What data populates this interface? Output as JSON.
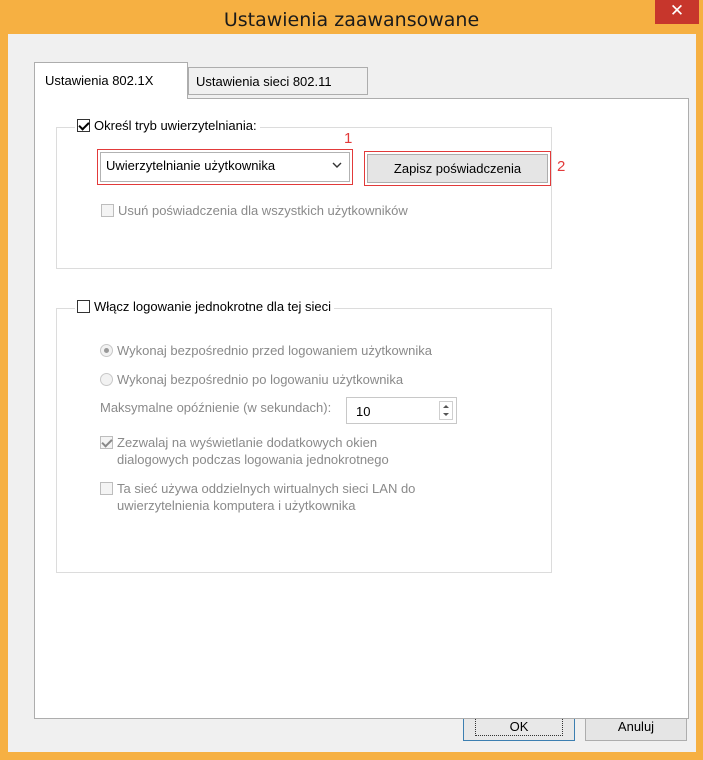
{
  "window": {
    "title": "Ustawienia zaawansowane",
    "close_label": "✕"
  },
  "tabs": [
    {
      "label": "Ustawienia 802.1X",
      "active": true
    },
    {
      "label": "Ustawienia sieci 802.11",
      "active": false
    }
  ],
  "auth_group": {
    "checkbox_label": "Określ tryb uwierzytelniania:",
    "checked": true,
    "mode_selected": "Uwierzytelnianie użytkownika",
    "save_credentials_label": "Zapisz poświadczenia",
    "delete_credentials_label": "Usuń poświadczenia dla wszystkich użytkowników",
    "marker_1": "1",
    "marker_2": "2"
  },
  "sso_group": {
    "checkbox_label": "Włącz logowanie jednokrotne dla tej sieci",
    "checked": false,
    "radio_before": "Wykonaj bezpośrednio przed logowaniem użytkownika",
    "radio_after": "Wykonaj bezpośrednio po logowaniu użytkownika",
    "delay_label": "Maksymalne opóźnienie (w sekundach):",
    "delay_value": "10",
    "allow_dialogs_line1": "Zezwalaj na wyświetlanie dodatkowych okien",
    "allow_dialogs_line2": "dialogowych podczas logowania jednokrotnego",
    "vlan_line1": "Ta sieć używa oddzielnych wirtualnych sieci LAN do",
    "vlan_line2": "uwierzytelnienia komputera i użytkownika"
  },
  "footer": {
    "ok_label": "OK",
    "cancel_label": "Anuluj"
  },
  "colors": {
    "title_bar": "#f6b042",
    "close_button": "#c7362c",
    "annotation": "#e23a3a"
  }
}
